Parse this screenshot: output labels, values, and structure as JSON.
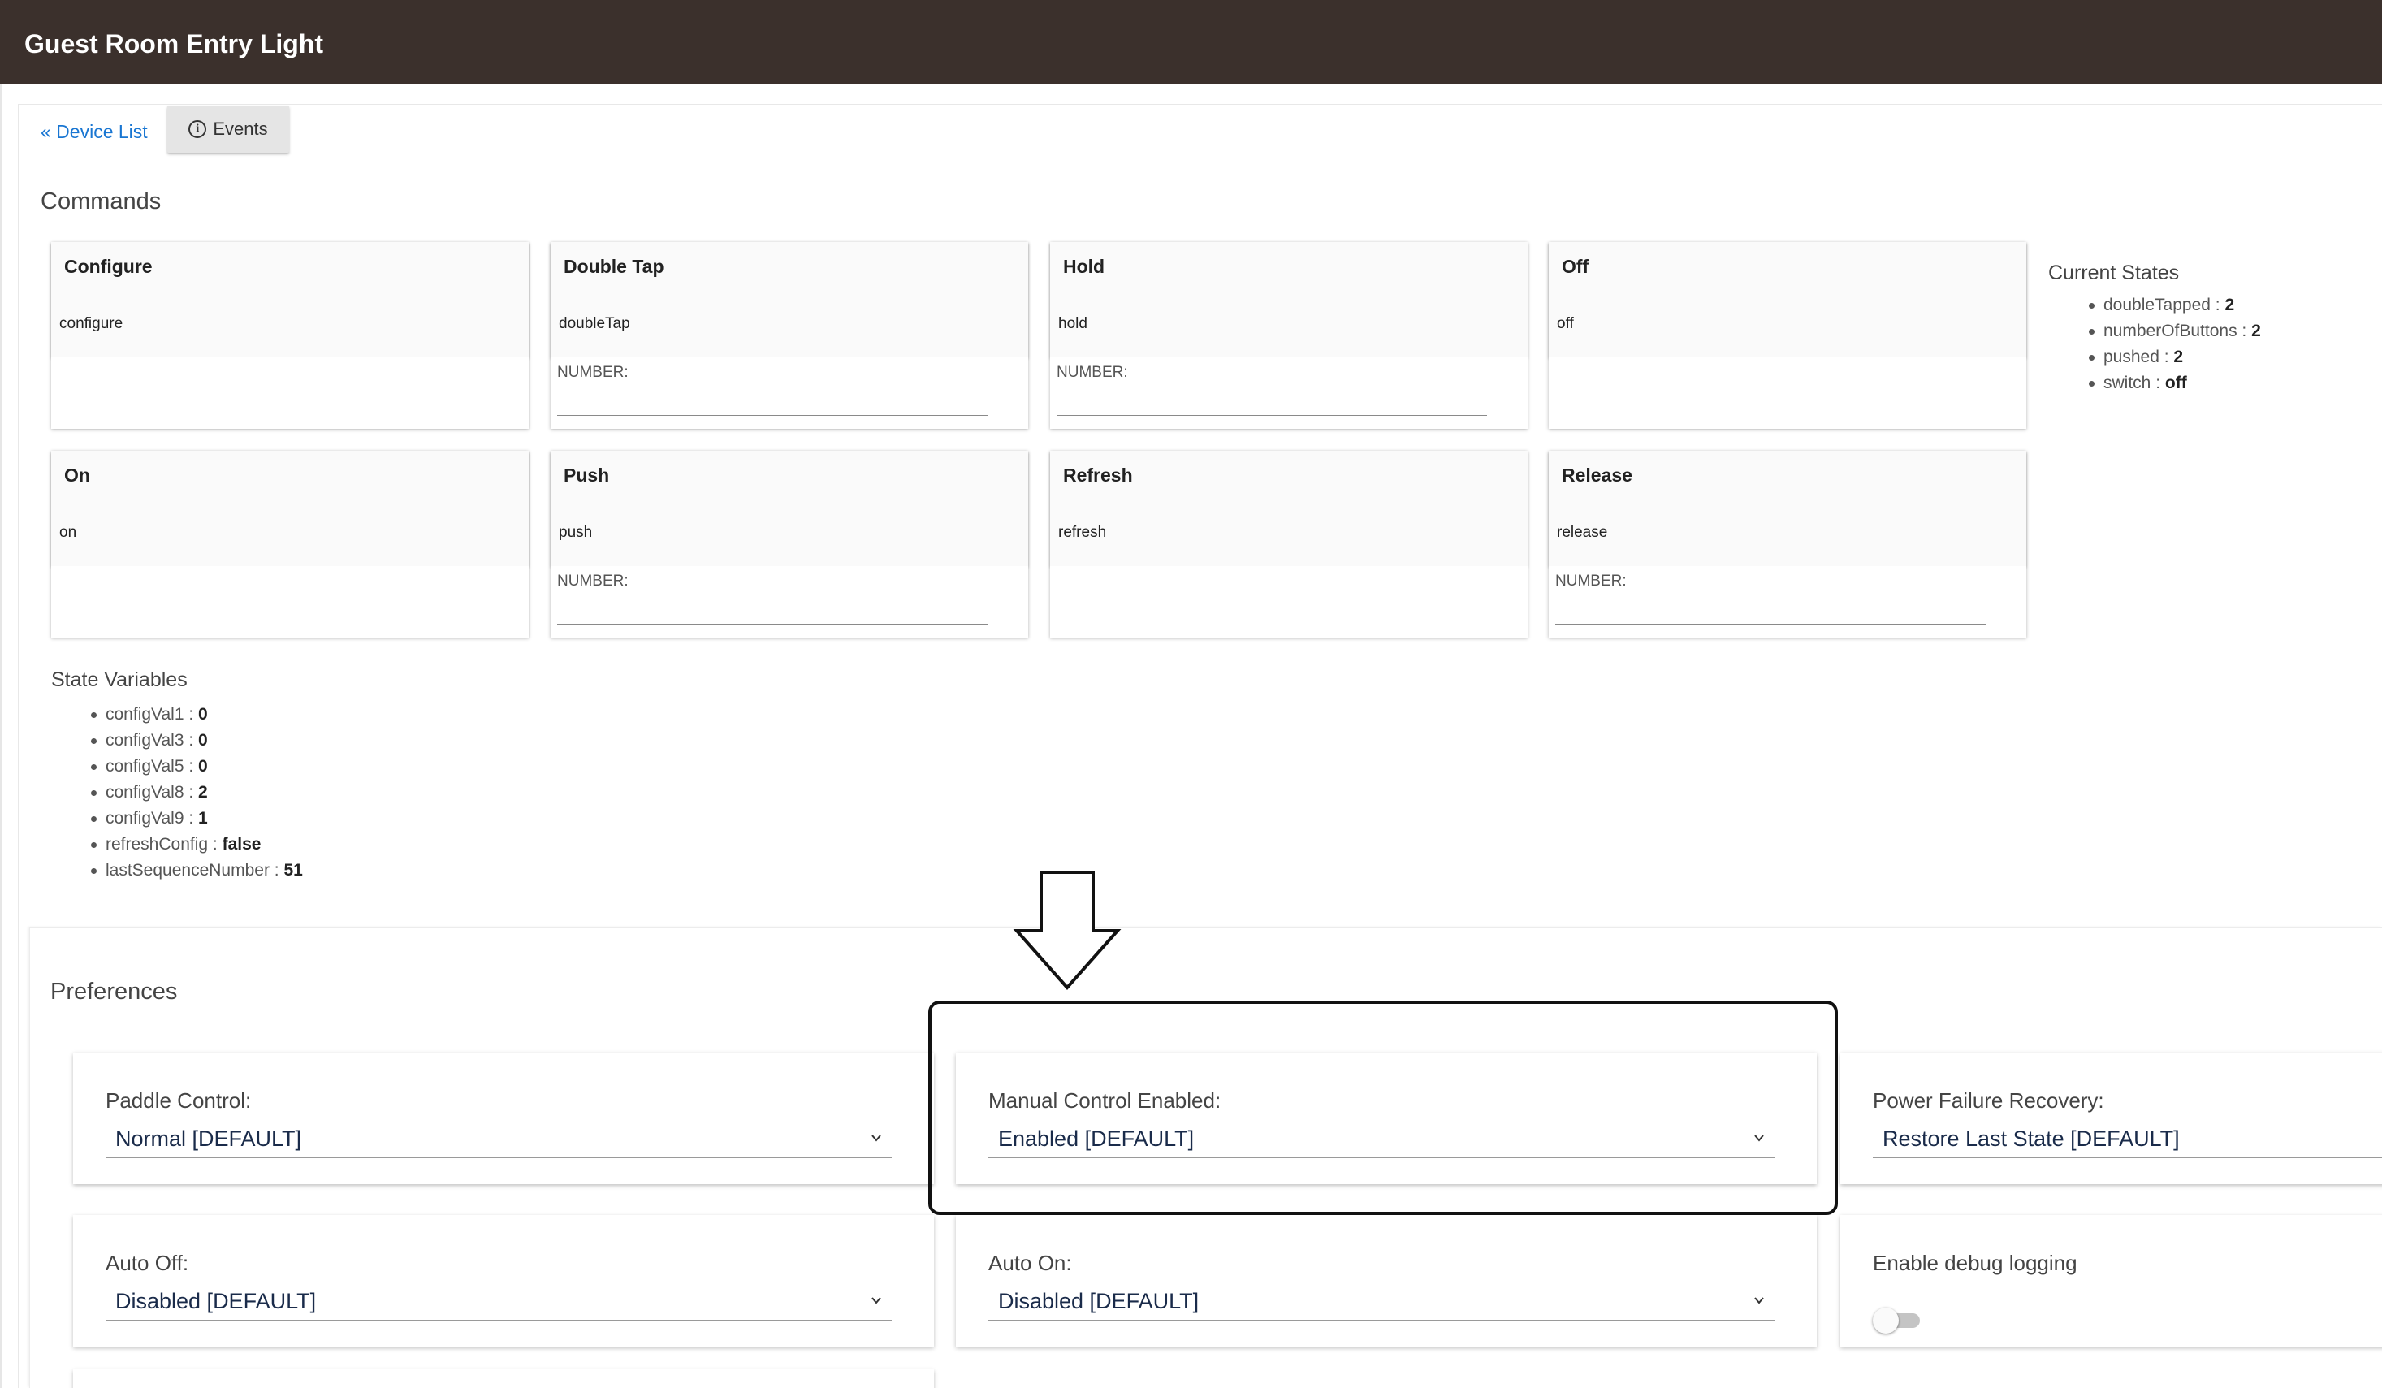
{
  "header": {
    "title": "Guest Room Entry Light"
  },
  "nav": {
    "device_list_label": "« Device List",
    "events_label": "Events"
  },
  "commands": {
    "heading": "Commands",
    "items": [
      {
        "title": "Configure",
        "method": "configure",
        "param_label": ""
      },
      {
        "title": "Double Tap",
        "method": "doubleTap",
        "param_label": "NUMBER:"
      },
      {
        "title": "Hold",
        "method": "hold",
        "param_label": "NUMBER:"
      },
      {
        "title": "Off",
        "method": "off",
        "param_label": ""
      },
      {
        "title": "On",
        "method": "on",
        "param_label": ""
      },
      {
        "title": "Push",
        "method": "push",
        "param_label": "NUMBER:"
      },
      {
        "title": "Refresh",
        "method": "refresh",
        "param_label": ""
      },
      {
        "title": "Release",
        "method": "release",
        "param_label": "NUMBER:"
      }
    ]
  },
  "current_states": {
    "heading": "Current States",
    "items": [
      {
        "key": "doubleTapped",
        "value": "2"
      },
      {
        "key": "numberOfButtons",
        "value": "2"
      },
      {
        "key": "pushed",
        "value": "2"
      },
      {
        "key": "switch",
        "value": "off"
      }
    ]
  },
  "state_variables": {
    "heading": "State Variables",
    "items": [
      {
        "key": "configVal1",
        "value": "0"
      },
      {
        "key": "configVal3",
        "value": "0"
      },
      {
        "key": "configVal5",
        "value": "0"
      },
      {
        "key": "configVal8",
        "value": "2"
      },
      {
        "key": "configVal9",
        "value": "1"
      },
      {
        "key": "refreshConfig",
        "value": "false"
      },
      {
        "key": "lastSequenceNumber",
        "value": "51"
      }
    ]
  },
  "preferences": {
    "heading": "Preferences",
    "paddle_control": {
      "label": "Paddle Control:",
      "value": "Normal [DEFAULT]"
    },
    "manual_control": {
      "label": "Manual Control Enabled:",
      "value": "Enabled [DEFAULT]"
    },
    "power_failure": {
      "label": "Power Failure Recovery:",
      "value": "Restore Last State [DEFAULT]"
    },
    "auto_off": {
      "label": "Auto Off:",
      "value": "Disabled [DEFAULT]"
    },
    "auto_on": {
      "label": "Auto On:",
      "value": "Disabled [DEFAULT]"
    },
    "debug_logging": {
      "label": "Enable debug logging",
      "enabled": false
    }
  }
}
